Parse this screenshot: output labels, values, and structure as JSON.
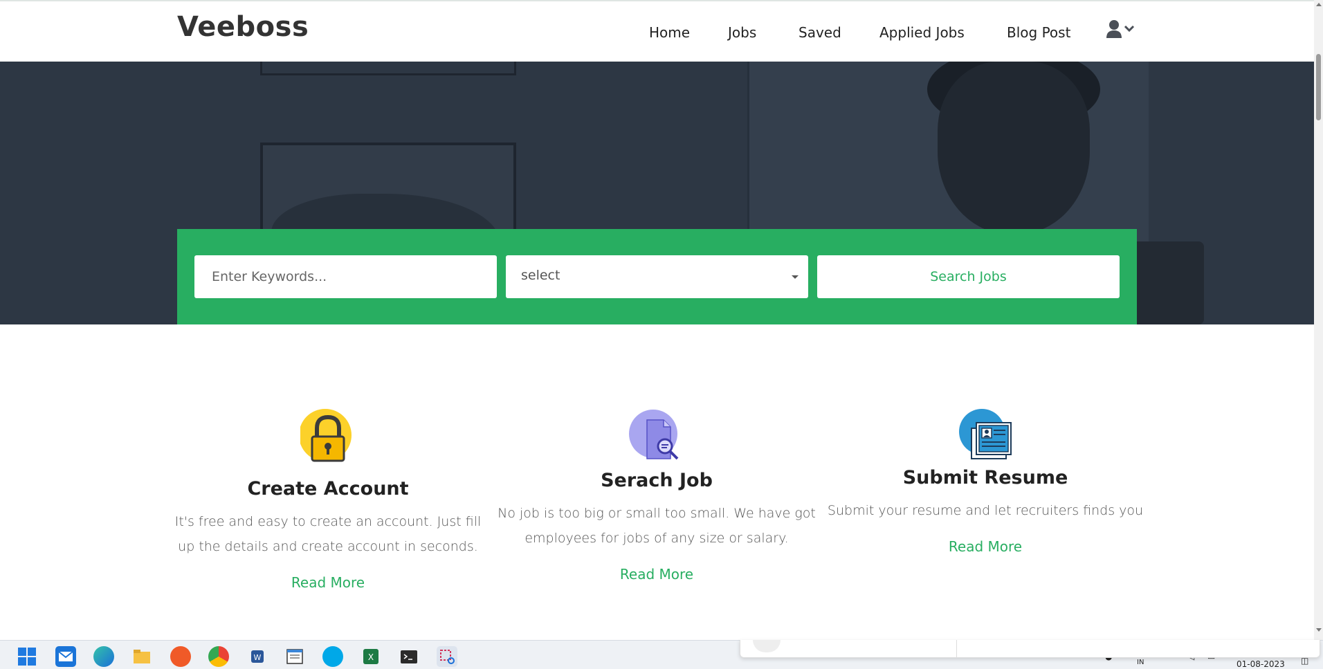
{
  "brand": "Veeboss",
  "nav": {
    "items": [
      {
        "label": "Home"
      },
      {
        "label": "Jobs"
      },
      {
        "label": "Saved"
      },
      {
        "label": "Applied Jobs"
      },
      {
        "label": "Blog Post"
      }
    ]
  },
  "search": {
    "keywords_placeholder": "Enter Keywords...",
    "keywords_value": "",
    "select_value": "select",
    "button_label": "Search Jobs"
  },
  "features": [
    {
      "title": "Create Account",
      "description": "It's free and easy to create an account. Just fill up the details and create account in seconds.",
      "link": "Read More",
      "icon": "padlock-icon"
    },
    {
      "title": "Serach Job",
      "description": "No job is too big or small too small. We have got employees for jobs of any size or salary.",
      "link": "Read More",
      "icon": "document-search-icon"
    },
    {
      "title": "Submit Resume",
      "description": "Submit your resume and let recruiters finds you",
      "link": "Read More",
      "icon": "resume-icon"
    }
  ],
  "colors": {
    "accent": "#28ae61",
    "hero_overlay": "#2d3744",
    "heading": "#222222",
    "body_text": "#555555"
  },
  "taskbar": {
    "apps": [
      "windows-start-icon",
      "mail-icon",
      "edge-icon",
      "file-explorer-icon",
      "paint-icon",
      "chrome-icon",
      "word-icon",
      "notepad-icon",
      "skype-icon",
      "excel-icon",
      "terminal-icon",
      "snipping-tool-icon"
    ],
    "tray": {
      "language": "IN",
      "date": "01-08-2023"
    }
  }
}
